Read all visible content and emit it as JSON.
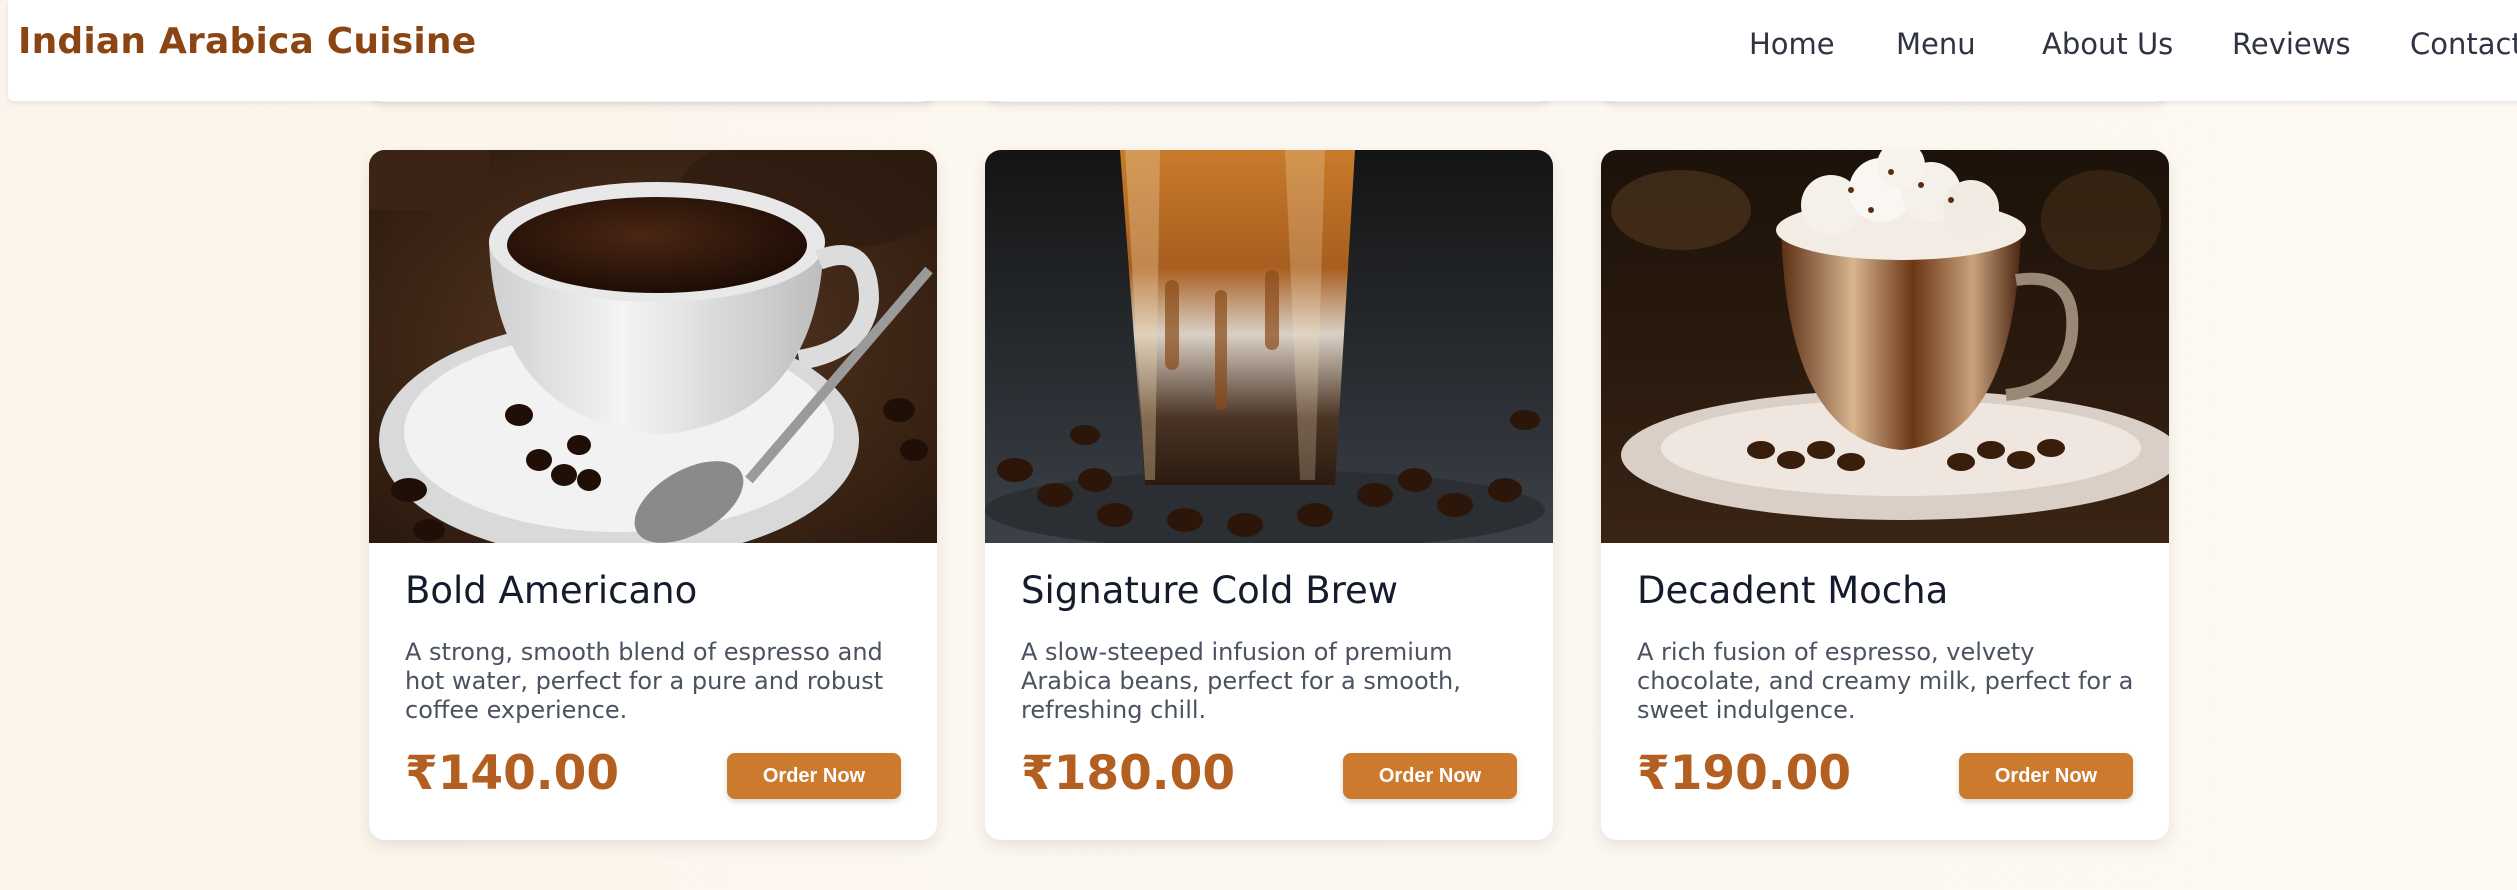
{
  "header": {
    "brand": "Indian Arabica Cuisine",
    "nav": [
      "Home",
      "Menu",
      "About Us",
      "Reviews",
      "Contact"
    ]
  },
  "colors": {
    "brand": "#8b4513",
    "price": "#b35f22",
    "button": "#cc7a2d",
    "background": "#fcf6ec"
  },
  "products": [
    {
      "title": "Bold Americano",
      "description": "A strong, smooth blend of espresso and hot water, perfect for a pure and robust coffee experience.",
      "price": "₹140.00",
      "button": "Order Now",
      "image": "americano-photo"
    },
    {
      "title": "Signature Cold Brew",
      "description": "A slow-steeped infusion of premium Arabica beans, perfect for a smooth, refreshing chill.",
      "price": "₹180.00",
      "button": "Order Now",
      "image": "cold-brew-photo"
    },
    {
      "title": "Decadent Mocha",
      "description": "A rich fusion of espresso, velvety chocolate, and creamy milk, perfect for a sweet indulgence.",
      "price": "₹190.00",
      "button": "Order Now",
      "image": "mocha-photo"
    }
  ]
}
